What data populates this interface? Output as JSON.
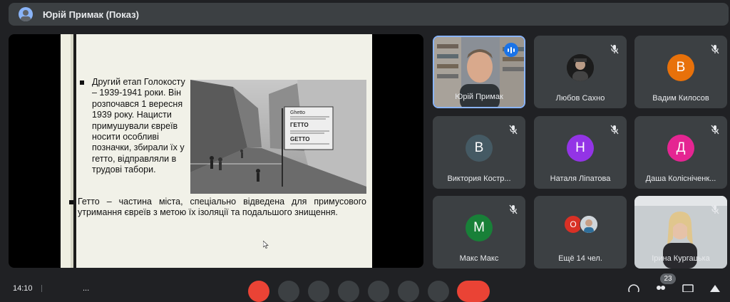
{
  "header": {
    "title": "Юрій Примак (Показ)"
  },
  "slide": {
    "bullet1": "Другий етап Голокосту – 1939-1941 роки. Він розпочався 1 вересня 1939 року. Нацисти примушували євреїв носити особливі позначки, збирали їх у гетто, відправляли в трудові табори.",
    "bullet2": "Гетто – частина міста, спеціально відведена для примусового утримання євреїв з метою їх ізоляції та подальшого знищення.",
    "sign_line1": "Ghetto",
    "sign_line2": "ГЕТТО",
    "sign_line3": "GETTO"
  },
  "participants": [
    {
      "name": "Юрій Примак",
      "type": "video",
      "speaking": true
    },
    {
      "name": "Любов Сахно",
      "type": "avatar-photo",
      "muted": true
    },
    {
      "name": "Вадим Килосов",
      "type": "letter",
      "letter": "В",
      "color": "#e8710a",
      "muted": true
    },
    {
      "name": "Виктория Костр...",
      "type": "letter",
      "letter": "В",
      "color": "#455a64",
      "muted": true
    },
    {
      "name": "Наталя Ліпатова",
      "type": "letter",
      "letter": "Н",
      "color": "#9334e6",
      "muted": true
    },
    {
      "name": "Даша Колісніченк...",
      "type": "letter",
      "letter": "Д",
      "color": "#e52592",
      "muted": true
    },
    {
      "name": "Макс Макс",
      "type": "letter",
      "letter": "М",
      "color": "#188038",
      "muted": true
    },
    {
      "name": "Ещё 14 чел.",
      "type": "more",
      "letter": "О",
      "color": "#d93025"
    },
    {
      "name": "Ірина Кургацька",
      "type": "video",
      "muted": true
    }
  ],
  "bottom": {
    "time": "14:10",
    "meeting_code": "...",
    "participants_count": "23"
  },
  "icons": [
    "mic-off-icon",
    "camera-icon",
    "captions-icon",
    "emoji-icon",
    "present-icon",
    "raise-hand-icon",
    "more-options-icon",
    "end-call-icon",
    "info-icon",
    "people-icon",
    "chat-icon",
    "activities-icon"
  ]
}
